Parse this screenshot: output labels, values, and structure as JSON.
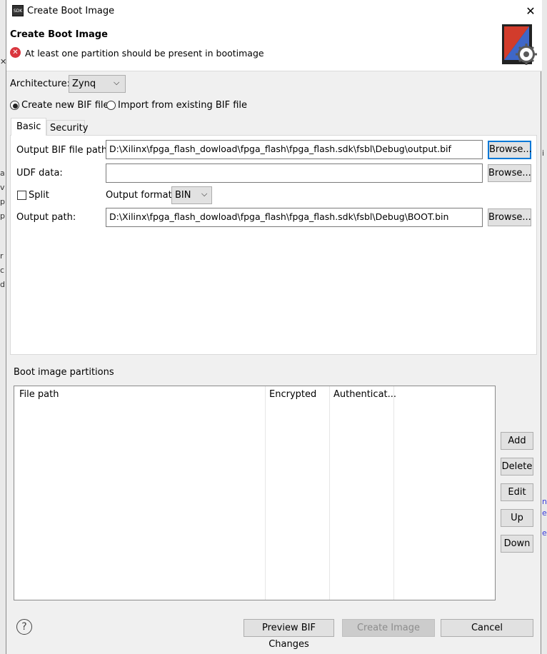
{
  "window": {
    "title": "Create Boot Image",
    "close_glyph": "✕"
  },
  "header": {
    "title": "Create Boot Image",
    "error_message": "At least one partition should be present in bootimage"
  },
  "architecture": {
    "label": "Architecture:",
    "value": "Zynq"
  },
  "bif_mode": {
    "create_new": "Create new BIF file",
    "import_existing": "Import from existing BIF file",
    "selected": "create_new"
  },
  "tabs": [
    {
      "label": "Basic",
      "active": true
    },
    {
      "label": "Security",
      "active": false
    }
  ],
  "basic": {
    "output_bif_label": "Output BIF file path:",
    "output_bif_value": "D:\\Xilinx\\fpga_flash_dowload\\fpga_flash\\fpga_flash.sdk\\fsbl\\Debug\\output.bif",
    "udf_label": "UDF data:",
    "udf_value": "",
    "split_label": "Split",
    "split_checked": false,
    "output_format_label": "Output format:",
    "output_format_value": "BIN",
    "output_path_label": "Output path:",
    "output_path_value": "D:\\Xilinx\\fpga_flash_dowload\\fpga_flash\\fpga_flash.sdk\\fsbl\\Debug\\BOOT.bin",
    "browse_label": "Browse..."
  },
  "partitions": {
    "title": "Boot image partitions",
    "columns": [
      "File path",
      "Encrypted",
      "Authenticat..."
    ],
    "rows": [],
    "buttons": {
      "add": "Add",
      "delete": "Delete",
      "edit": "Edit",
      "up": "Up",
      "down": "Down"
    }
  },
  "footer": {
    "help_glyph": "?",
    "preview": "Preview BIF Changes",
    "create": "Create Image",
    "cancel": "Cancel"
  },
  "colors": {
    "focus_blue": "#0078d7",
    "error_red": "#d9363e",
    "disabled_text": "#8c8c8c"
  }
}
